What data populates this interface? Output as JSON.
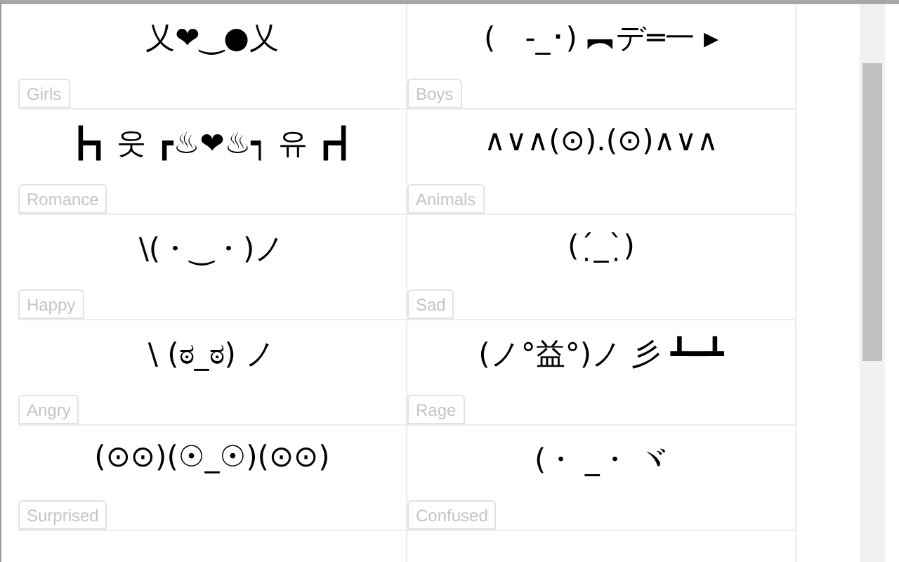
{
  "cards": [
    {
      "emoticon": "乂❤‿●乂",
      "label": "Girls"
    },
    {
      "emoticon": "(　-_･) ︻デ═一 ▸",
      "label": "Boys"
    },
    {
      "emoticon": "┣┓ 웃 ┏♨❤♨┑ 유 ┏┫",
      "label": "Romance"
    },
    {
      "emoticon": "∧∨∧(⊙).(⊙)∧∨∧",
      "label": "Animals"
    },
    {
      "emoticon": "\\(・‿・)ノ",
      "label": "Happy"
    },
    {
      "emoticon": "(ˊ̣_ˋ̣)",
      "label": "Sad"
    },
    {
      "emoticon": "\\ (ಠ_ಠ) ノ",
      "label": "Angry"
    },
    {
      "emoticon": "(ノ°益°)ノ 彡 ┻━┻",
      "label": "Rage"
    },
    {
      "emoticon": "(⊙⊙)(☉_☉)(⊙⊙)",
      "label": "Surprised"
    },
    {
      "emoticon": "(・ _・ ヾ",
      "label": "Confused"
    }
  ]
}
